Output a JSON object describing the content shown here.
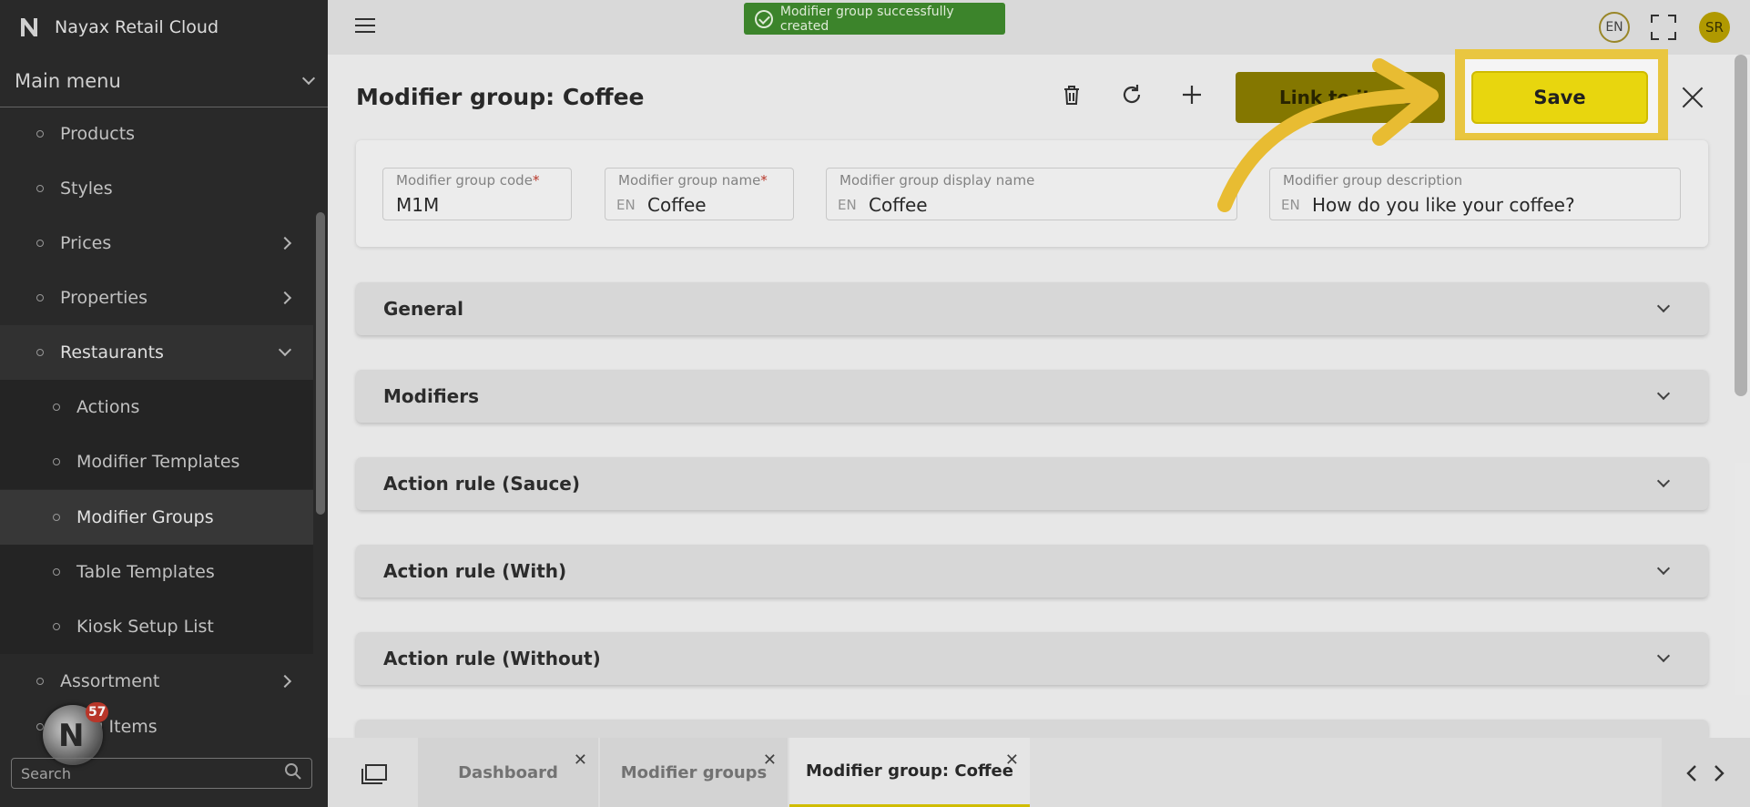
{
  "app": {
    "name": "Nayax Retail Cloud"
  },
  "sidebar": {
    "main_menu_label": "Main menu",
    "items": [
      {
        "label": "Products",
        "has_arrow": false
      },
      {
        "label": "Styles",
        "has_arrow": false
      },
      {
        "label": "Prices",
        "has_arrow": true
      },
      {
        "label": "Properties",
        "has_arrow": true
      },
      {
        "label": "Restaurants",
        "has_arrow": true,
        "expanded": true
      },
      {
        "label": "Actions"
      },
      {
        "label": "Modifier Templates"
      },
      {
        "label": "Modifier Groups",
        "selected": true
      },
      {
        "label": "Table Templates"
      },
      {
        "label": "Kiosk Setup List"
      },
      {
        "label": "Assortment",
        "has_arrow": true
      },
      {
        "label": "...ing Items"
      }
    ],
    "search_placeholder": "Search",
    "notification_count": "57"
  },
  "topbar": {
    "toast": "Modifier group successfully created",
    "language": "EN",
    "user_initials": "SR"
  },
  "header": {
    "title": "Modifier group: Coffee",
    "link_button": "Link to items",
    "save_button": "Save"
  },
  "fields": {
    "code": {
      "label": "Modifier group code",
      "value": "M1M"
    },
    "name": {
      "label": "Modifier group name",
      "lang": "EN",
      "value": "Coffee"
    },
    "display_name": {
      "label": "Modifier group display name",
      "lang": "EN",
      "value": "Coffee"
    },
    "description": {
      "label": "Modifier group description",
      "lang": "EN",
      "value": "How do you like your coffee?"
    },
    "required_mark": "*"
  },
  "sections": [
    {
      "title": "General"
    },
    {
      "title": "Modifiers"
    },
    {
      "title": "Action rule (Sauce)"
    },
    {
      "title": "Action rule (With)"
    },
    {
      "title": "Action rule (Without)"
    }
  ],
  "bottom_tabs": [
    {
      "label": "Dashboard",
      "close": "✕"
    },
    {
      "label": "Modifier groups",
      "close": "✕"
    },
    {
      "label": "Modifier group: Coffee",
      "close": "✕",
      "active": true
    }
  ],
  "colors": {
    "accent_yellow": "#f2df0f",
    "highlight_frame": "#f3cf43",
    "toast_green": "#3f8a2d",
    "sidebar_bg": "#2b2b2b"
  }
}
